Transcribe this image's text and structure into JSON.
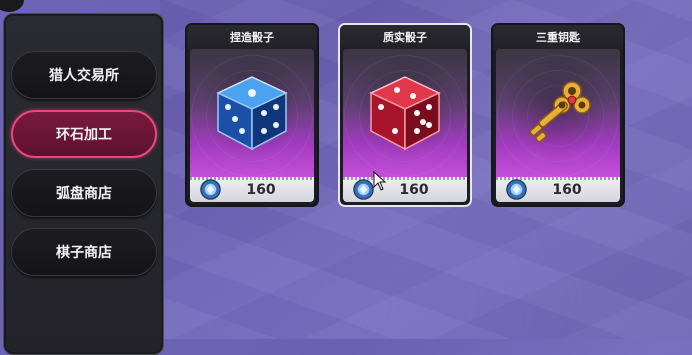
{
  "sidebar": {
    "items": [
      {
        "label": "猎人交易所",
        "active": false
      },
      {
        "label": "环石加工",
        "active": true
      },
      {
        "label": "弧盘商店",
        "active": false
      },
      {
        "label": "棋子商店",
        "active": false
      }
    ]
  },
  "shop": {
    "items": [
      {
        "title": "捏造骰子",
        "price": "160",
        "icon": "blue-dice-icon",
        "currency_icon": "crystal-coin-icon",
        "selected": false
      },
      {
        "title": "质实骰子",
        "price": "160",
        "icon": "red-dice-icon",
        "currency_icon": "crystal-coin-icon",
        "selected": true
      },
      {
        "title": "三重钥匙",
        "price": "160",
        "icon": "golden-key-icon",
        "currency_icon": "crystal-coin-icon",
        "selected": false
      }
    ]
  },
  "colors": {
    "active_tab_border": "#e8487a",
    "card_art_gradient_end": "#c24fd8",
    "background": "#6f65b8"
  }
}
